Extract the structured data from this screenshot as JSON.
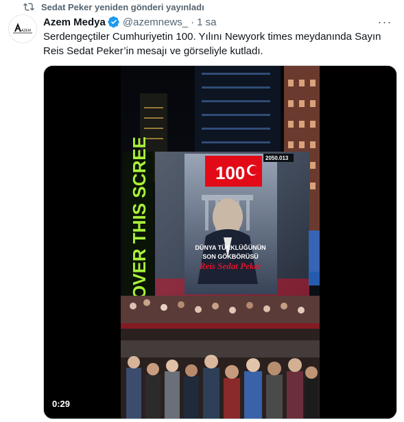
{
  "retweet": {
    "label": "Sedat Peker yeniden gönderi yayınladı"
  },
  "tweet": {
    "author_name": "Azem Medya",
    "handle": "@azemnews_",
    "separator": "·",
    "time": "1 sa",
    "more_label": "···",
    "text_line1": "Serdengeçtiler Cumhuriyetin 100. Yılını Newyork times meydanında Sayın",
    "text_line2": "Reis Sedat Peker’in mesajı ve görseliyle kutladı.",
    "avatar_text": "AZEM"
  },
  "video": {
    "duration": "0:29",
    "billboard_side_text": "OVER THIS SCREE",
    "billboard_counter": "2050.013",
    "badge_number": "100",
    "headline1": "DÜNYA TÜRKLÜĞÜNÜN",
    "headline2": "SON GÖKBÖRÜSÜ",
    "script_name": "Reis Sedat Peker"
  },
  "colors": {
    "accent": "#1d9bf0",
    "muted": "#536471",
    "text": "#0f1419",
    "turkish_red": "#e30a17"
  }
}
